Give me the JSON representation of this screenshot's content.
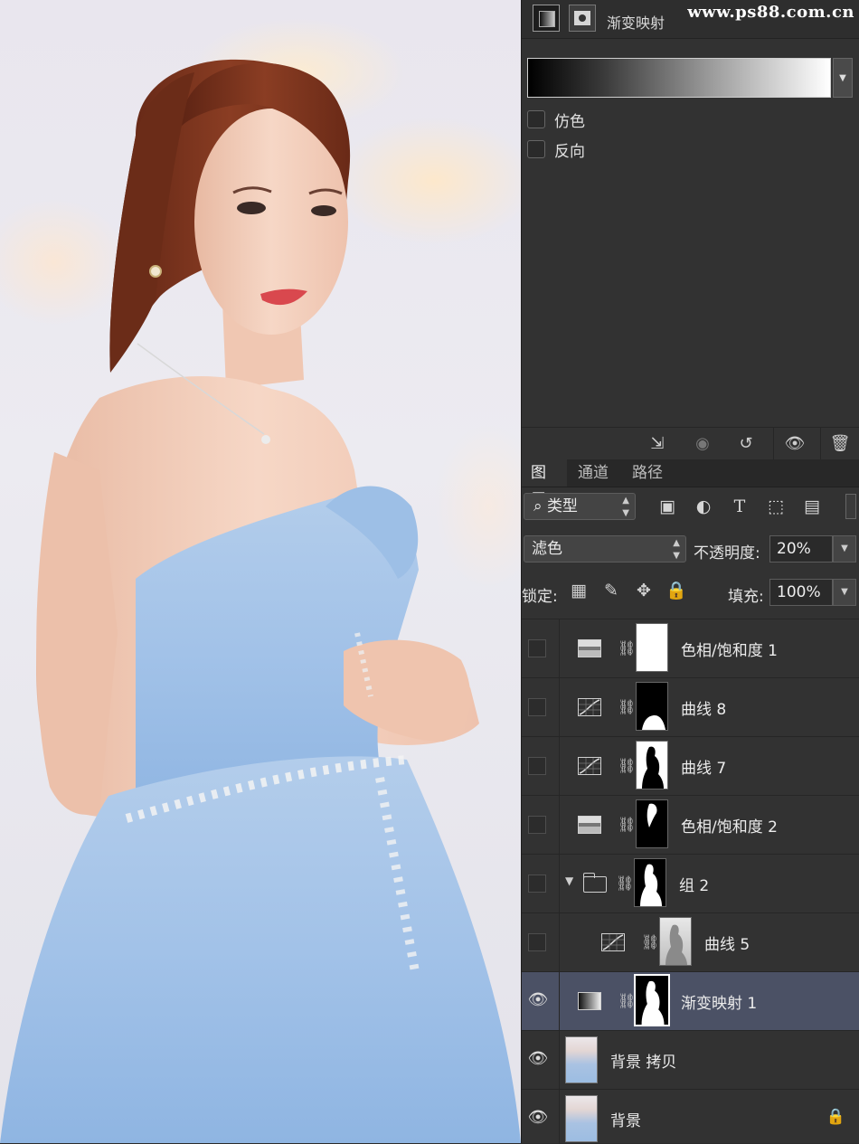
{
  "properties": {
    "title": "渐变映射",
    "watermark": "www.ps88.com.cn",
    "dither_label": "仿色",
    "reverse_label": "反向"
  },
  "layers_panel": {
    "tabs": [
      {
        "label": "图层"
      },
      {
        "label": "通道"
      },
      {
        "label": "路径"
      }
    ],
    "filter_kind": "类型",
    "blend_mode": "滤色",
    "opacity_label": "不透明度:",
    "opacity_value": "20%",
    "lock_label": "锁定:",
    "fill_label": "填充:",
    "fill_value": "100%",
    "layers": [
      {
        "name": "色相/饱和度 1",
        "visible": false,
        "type": "hue-saturation"
      },
      {
        "name": "曲线 8",
        "visible": false,
        "type": "curves"
      },
      {
        "name": "曲线 7",
        "visible": false,
        "type": "curves"
      },
      {
        "name": "色相/饱和度 2",
        "visible": false,
        "type": "hue-saturation"
      },
      {
        "name": "组 2",
        "visible": false,
        "type": "group"
      },
      {
        "name": "曲线 5",
        "visible": false,
        "type": "curves"
      },
      {
        "name": "渐变映射 1",
        "visible": true,
        "type": "gradient-map",
        "selected": true
      },
      {
        "name": "背景 拷贝",
        "visible": true,
        "type": "pixel"
      },
      {
        "name": "背景",
        "visible": true,
        "type": "pixel",
        "locked": true
      }
    ]
  },
  "colors": {
    "panel_bg": "#323232",
    "selected_layer": "#4b5165",
    "dress": "#a7c6ea",
    "hair": "#7a3520"
  }
}
